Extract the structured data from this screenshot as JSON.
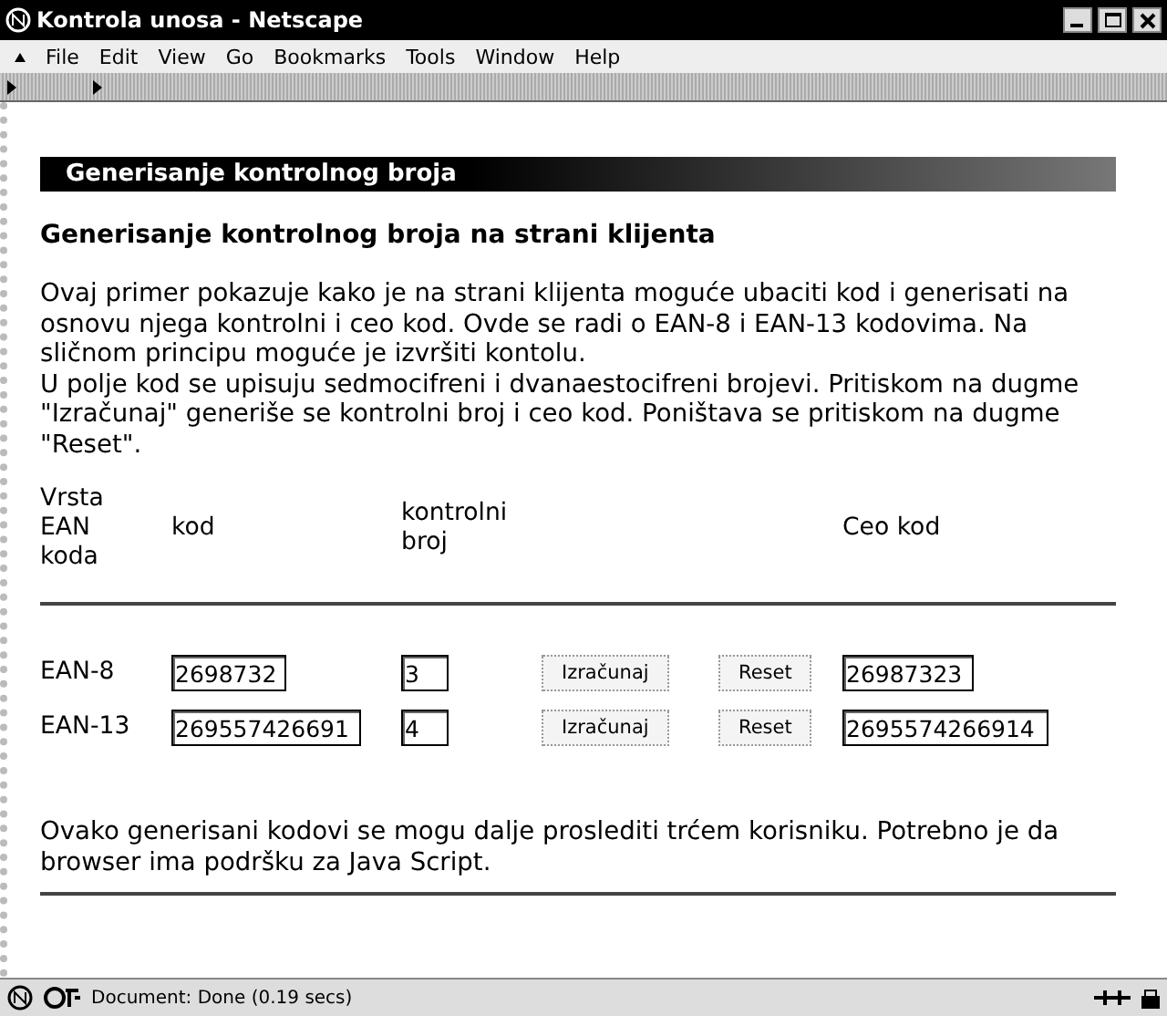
{
  "window": {
    "title": "Kontrola unosa - Netscape"
  },
  "menu": [
    "File",
    "Edit",
    "View",
    "Go",
    "Bookmarks",
    "Tools",
    "Window",
    "Help"
  ],
  "banner": "Generisanje kontrolnog broja",
  "heading": "Generisanje kontrolnog broja na strani klijenta",
  "paragraphs": [
    "Ovaj primer pokazuje kako je na strani klijenta moguće ubaciti kod i generisati na osnovu njega kontrolni i ceo kod. Ovde se radi o EAN-8 i EAN-13 kodovima. Na sličnom principu moguće je izvršiti kontolu.",
    "U polje kod se upisuju sedmocifreni i dvanaestocifreni brojevi. Pritiskom na dugme \"Izračunaj\" generiše se kontrolni broj i ceo kod. Poništava se pritiskom na dugme \"Reset\"."
  ],
  "table": {
    "columns": [
      "Vrsta EAN koda",
      "kod",
      "kontrolni broj",
      "Ceo kod"
    ],
    "rows": [
      {
        "type": "EAN-8",
        "kod": "2698732",
        "kontrolni": "3",
        "calc_button": "Izračunaj",
        "reset_button": "Reset",
        "ceo": "26987323"
      },
      {
        "type": "EAN-13",
        "kod": "269557426691",
        "kontrolni": "4",
        "calc_button": "Izračunaj",
        "reset_button": "Reset",
        "ceo": "2695574266914"
      }
    ]
  },
  "footer_text": "Ovako generisani kodovi se mogu dalje proslediti trćem korisniku. Potrebno je da browser ima podršku za Java Script.",
  "status_bar": {
    "text": "Document: Done (0.19 secs)"
  }
}
